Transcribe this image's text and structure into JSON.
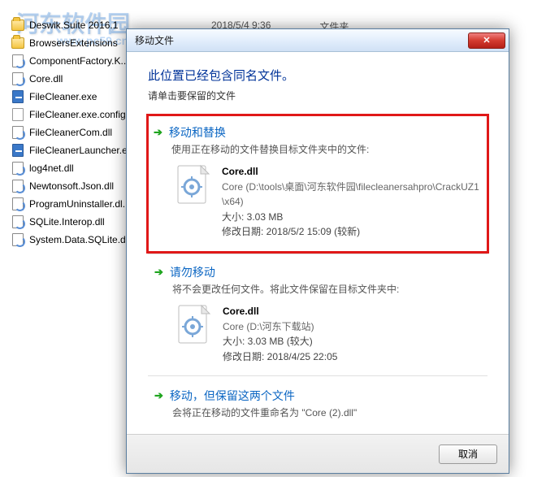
{
  "explorer": {
    "header_date": "2018/5/4 9:36",
    "header_type": "文件夹",
    "files": [
      {
        "name": "Deswik.Suite 2016.1",
        "icon": "folder"
      },
      {
        "name": "BrowsersExtensions",
        "icon": "folder"
      },
      {
        "name": "ComponentFactory.K...",
        "icon": "dll"
      },
      {
        "name": "Core.dll",
        "icon": "dll"
      },
      {
        "name": "FileCleaner.exe",
        "icon": "exe"
      },
      {
        "name": "FileCleaner.exe.config",
        "icon": "cfg"
      },
      {
        "name": "FileCleanerCom.dll",
        "icon": "dll"
      },
      {
        "name": "FileCleanerLauncher.e...",
        "icon": "exe"
      },
      {
        "name": "log4net.dll",
        "icon": "dll"
      },
      {
        "name": "Newtonsoft.Json.dll",
        "icon": "dll"
      },
      {
        "name": "ProgramUninstaller.dl...",
        "icon": "dll"
      },
      {
        "name": "SQLite.Interop.dll",
        "icon": "dll"
      },
      {
        "name": "System.Data.SQLite.dl...",
        "icon": "dll"
      }
    ]
  },
  "watermark": {
    "line1": "河东软件园",
    "line2": "www.pc59.cn"
  },
  "dialog": {
    "title": "移动文件",
    "headline": "此位置已经包含同名文件。",
    "subhead": "请单击要保留的文件",
    "option1": {
      "title": "移动和替换",
      "desc": "使用正在移动的文件替换目标文件夹中的文件:",
      "file": {
        "name": "Core.dll",
        "path": "Core (D:\\tools\\桌面\\河东软件园\\filecleanersahpro\\CrackUZ1\\x64)",
        "size_label": "大小: 3.03 MB",
        "date_label": "修改日期: 2018/5/2 15:09 (较新)"
      }
    },
    "option2": {
      "title": "请勿移动",
      "desc": "将不会更改任何文件。将此文件保留在目标文件夹中:",
      "file": {
        "name": "Core.dll",
        "path": "Core (D:\\河东下载站)",
        "size_label": "大小: 3.03 MB (较大)",
        "date_label": "修改日期: 2018/4/25 22:05"
      }
    },
    "option3": {
      "title": "移动，但保留这两个文件",
      "desc": "会将正在移动的文件重命名为 \"Core (2).dll\""
    },
    "cancel": "取消"
  }
}
